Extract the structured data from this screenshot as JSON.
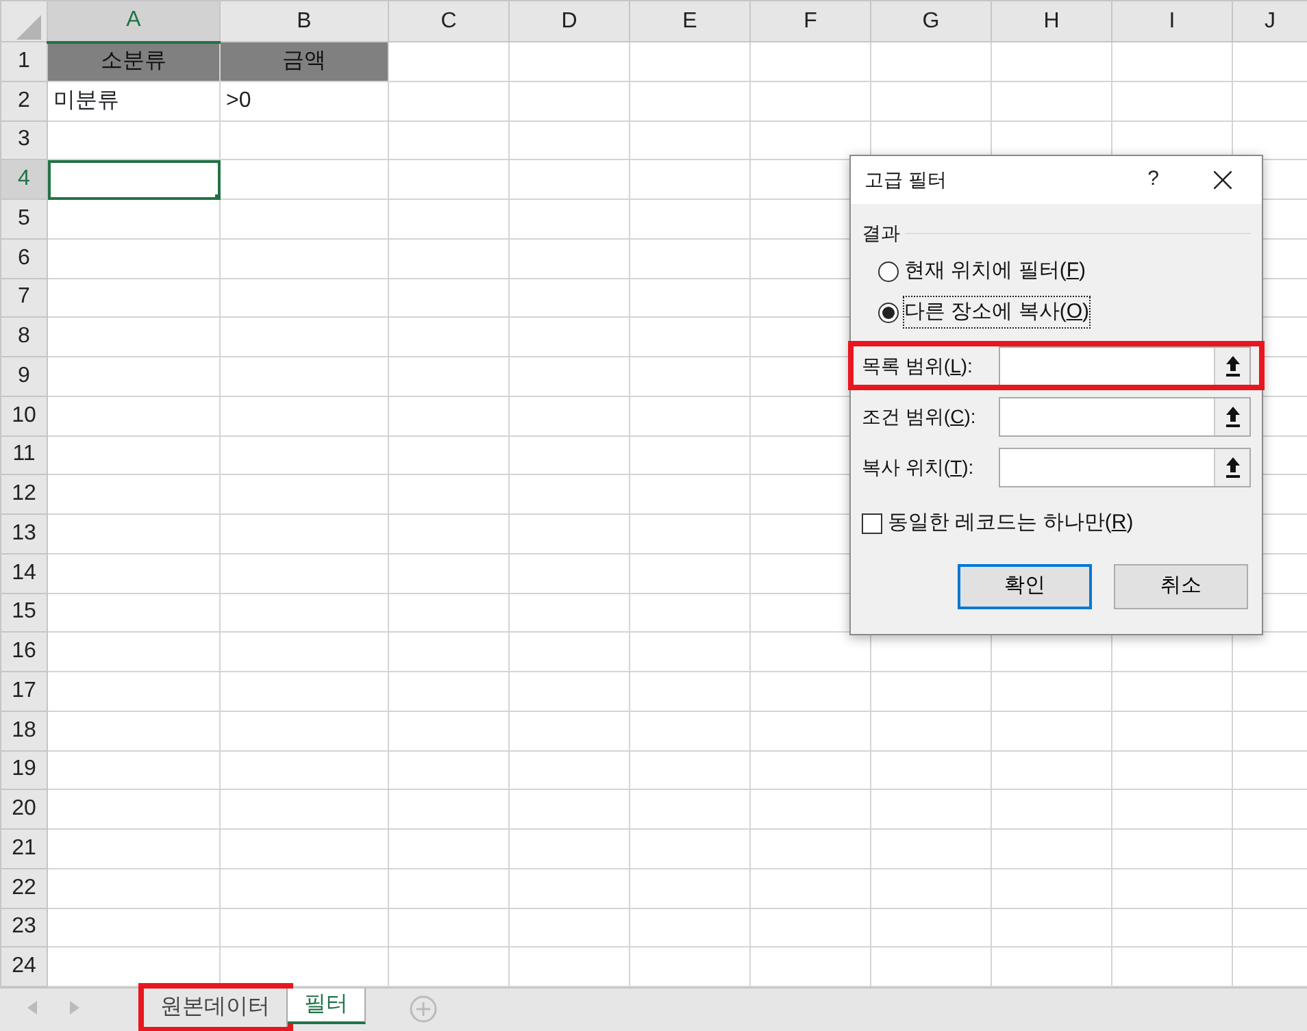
{
  "sheet": {
    "columns": [
      {
        "label": "A",
        "selected": true
      },
      {
        "label": "B",
        "selected": false
      },
      {
        "label": "C",
        "selected": false
      },
      {
        "label": "D",
        "selected": false
      },
      {
        "label": "E",
        "selected": false
      },
      {
        "label": "F",
        "selected": false
      },
      {
        "label": "G",
        "selected": false
      },
      {
        "label": "H",
        "selected": false
      },
      {
        "label": "I",
        "selected": false
      },
      {
        "label": "J",
        "selected": false
      }
    ],
    "rows": [
      {
        "label": "1",
        "selected": false,
        "cells": [
          {
            "text": "소분류",
            "kind": "header"
          },
          {
            "text": "금액",
            "kind": "header"
          }
        ]
      },
      {
        "label": "2",
        "selected": false,
        "cells": [
          {
            "text": "미분류",
            "kind": "value"
          },
          {
            "text": ">0",
            "kind": "value"
          }
        ]
      },
      {
        "label": "3",
        "selected": false,
        "cells": []
      },
      {
        "label": "4",
        "selected": true,
        "cells": [
          {
            "kind": "active"
          }
        ]
      },
      {
        "label": "5",
        "selected": false,
        "cells": []
      },
      {
        "label": "6",
        "selected": false,
        "cells": []
      },
      {
        "label": "7",
        "selected": false,
        "cells": []
      },
      {
        "label": "8",
        "selected": false,
        "cells": []
      },
      {
        "label": "9",
        "selected": false,
        "cells": []
      },
      {
        "label": "10",
        "selected": false,
        "cells": []
      },
      {
        "label": "11",
        "selected": false,
        "cells": []
      },
      {
        "label": "12",
        "selected": false,
        "cells": []
      },
      {
        "label": "13",
        "selected": false,
        "cells": []
      },
      {
        "label": "14",
        "selected": false,
        "cells": []
      },
      {
        "label": "15",
        "selected": false,
        "cells": []
      },
      {
        "label": "16",
        "selected": false,
        "cells": []
      },
      {
        "label": "17",
        "selected": false,
        "cells": []
      },
      {
        "label": "18",
        "selected": false,
        "cells": []
      },
      {
        "label": "19",
        "selected": false,
        "cells": []
      },
      {
        "label": "20",
        "selected": false,
        "cells": []
      },
      {
        "label": "21",
        "selected": false,
        "cells": []
      },
      {
        "label": "22",
        "selected": false,
        "cells": []
      },
      {
        "label": "23",
        "selected": false,
        "cells": []
      },
      {
        "label": "24",
        "selected": false,
        "cells": []
      }
    ]
  },
  "dialog": {
    "title": "고급 필터",
    "help": "?",
    "group": "결과",
    "radios": [
      {
        "before": "현재 위치에 필터(",
        "key": "F",
        "after": ")",
        "selected": false
      },
      {
        "before": "다른 장소에 복사(",
        "key": "O",
        "after": ")",
        "selected": true
      }
    ],
    "fields": [
      {
        "before": "목록 범위(",
        "key": "L",
        "after": "):",
        "highlighted": true
      },
      {
        "before": "조건 범위(",
        "key": "C",
        "after": "):",
        "highlighted": false
      },
      {
        "before": "복사 위치(",
        "key": "T",
        "after": "):",
        "highlighted": false
      }
    ],
    "checkbox": {
      "before": "동일한 레코드는 하나만(",
      "key": "R",
      "after": ")",
      "checked": false
    },
    "buttons": [
      {
        "label": "확인",
        "default": true
      },
      {
        "label": "취소",
        "default": false
      }
    ]
  },
  "sheet_tabs": [
    {
      "label": "원본데이터",
      "selected": false,
      "highlighted": true
    },
    {
      "label": "필터",
      "selected": true,
      "highlighted": false
    }
  ]
}
